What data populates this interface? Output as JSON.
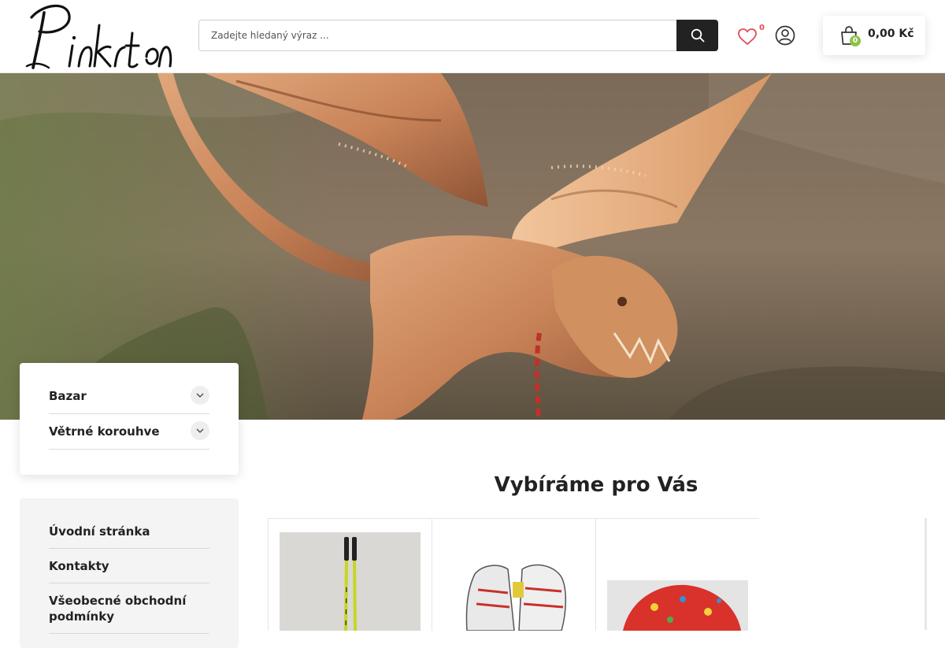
{
  "header": {
    "logo_text": "Pinkrton",
    "search": {
      "placeholder": "Zadejte hledaný výraz ..."
    },
    "wishlist_count": "0",
    "cart": {
      "count": "0",
      "total": "0,00 Kč"
    }
  },
  "colors": {
    "accent_dark": "#222222",
    "cart_badge": "#8bc34a",
    "wishlist_badge": "#e44a57"
  },
  "icons": {
    "search": "search-icon",
    "wishlist": "heart-icon",
    "account": "user-icon",
    "cart": "shopping-bag-icon",
    "category_toggle": "chevron-down-icon"
  },
  "categories": [
    {
      "label": "Bazar"
    },
    {
      "label": "Větrné korouhve"
    }
  ],
  "info_menu": [
    {
      "label": "Úvodní stránka"
    },
    {
      "label": "Kontakty"
    },
    {
      "label": "Všeobecné obchodní podmínky"
    }
  ],
  "recommended": {
    "title": "Vybíráme pro Vás"
  }
}
